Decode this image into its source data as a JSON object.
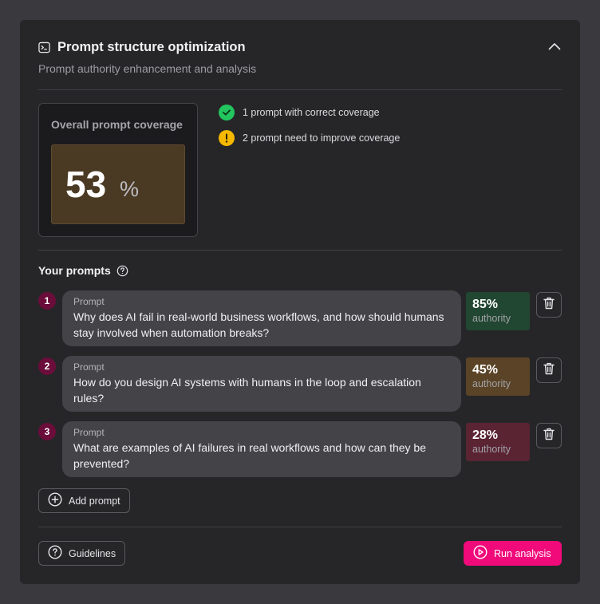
{
  "header": {
    "title": "Prompt structure optimization",
    "subtitle": "Prompt authority enhancement and analysis",
    "icon": "terminal-icon",
    "collapse_icon": "chevron-up-icon"
  },
  "coverage": {
    "label": "Overall prompt coverage",
    "value": "53",
    "unit": "%"
  },
  "status": [
    {
      "icon": "check-circle-icon",
      "text": "1 prompt with correct coverage",
      "color": "#22c55e"
    },
    {
      "icon": "warning-circle-icon",
      "text": "2 prompt need to improve coverage",
      "color": "#f5b800"
    }
  ],
  "prompts_section": {
    "title": "Your prompts",
    "help_icon": "question-circle-icon"
  },
  "prompts": [
    {
      "number": "1",
      "label": "Prompt",
      "text": "Why does AI fail in real-world business workflows, and how should humans stay involved when automation breaks?",
      "score": "85%",
      "score_label": "authority",
      "level": "green"
    },
    {
      "number": "2",
      "label": "Prompt",
      "text": "How do you design AI systems with humans in the loop and escalation rules?",
      "score": "45%",
      "score_label": "authority",
      "level": "amber"
    },
    {
      "number": "3",
      "label": "Prompt",
      "text": "What are examples of AI failures in real workflows and how can they be prevented?",
      "score": "28%",
      "score_label": "authority",
      "level": "red"
    }
  ],
  "actions": {
    "add_prompt": "Add prompt",
    "guidelines": "Guidelines",
    "run_analysis": "Run analysis"
  },
  "colors": {
    "accent": "#f00a7a",
    "badge": "#6b0d3a",
    "good": "#214631",
    "medium": "#5a4326",
    "poor": "#5a2433"
  }
}
